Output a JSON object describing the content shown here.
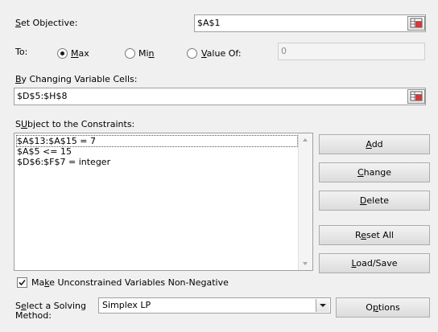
{
  "objective": {
    "label_access": "S",
    "label_rest": "et Objective:",
    "value": "$A$1"
  },
  "to": {
    "label": "To:",
    "options": [
      {
        "access": "M",
        "rest": "ax",
        "selected": true
      },
      {
        "prefix": "Mi",
        "access": "n",
        "selected": false
      },
      {
        "access": "V",
        "rest": "alue Of:",
        "selected": false
      }
    ],
    "value_of": "0"
  },
  "changing": {
    "label_access": "B",
    "label_rest": "y Changing Variable Cells:",
    "value": "$D$5:$H$8"
  },
  "constraints": {
    "label_access": "U",
    "label_rest": "bject to the Constraints:",
    "label_prefix": "S",
    "items": [
      "$A$13:$A$15 = 7",
      "$A$5 <= 15",
      "$D$6:$F$7 = integer"
    ]
  },
  "buttons": {
    "add": {
      "access": "A",
      "rest": "dd"
    },
    "change": {
      "access": "C",
      "rest": "hange"
    },
    "delete": {
      "access": "D",
      "rest": "elete"
    },
    "reset": {
      "prefix": "R",
      "access": "e",
      "rest": "set All"
    },
    "load": {
      "access": "L",
      "rest": "oad/Save"
    },
    "options": {
      "prefix": "O",
      "access": "p",
      "rest": "tions"
    }
  },
  "nonneg": {
    "prefix": "Ma",
    "access": "k",
    "rest": "e Unconstrained Variables Non-Negative",
    "checked": true
  },
  "method": {
    "label_line1_prefix": "S",
    "label_line1_access": "e",
    "label_line1_rest": "lect a Solving",
    "label_line2": "Method:",
    "selected": "Simplex LP"
  }
}
